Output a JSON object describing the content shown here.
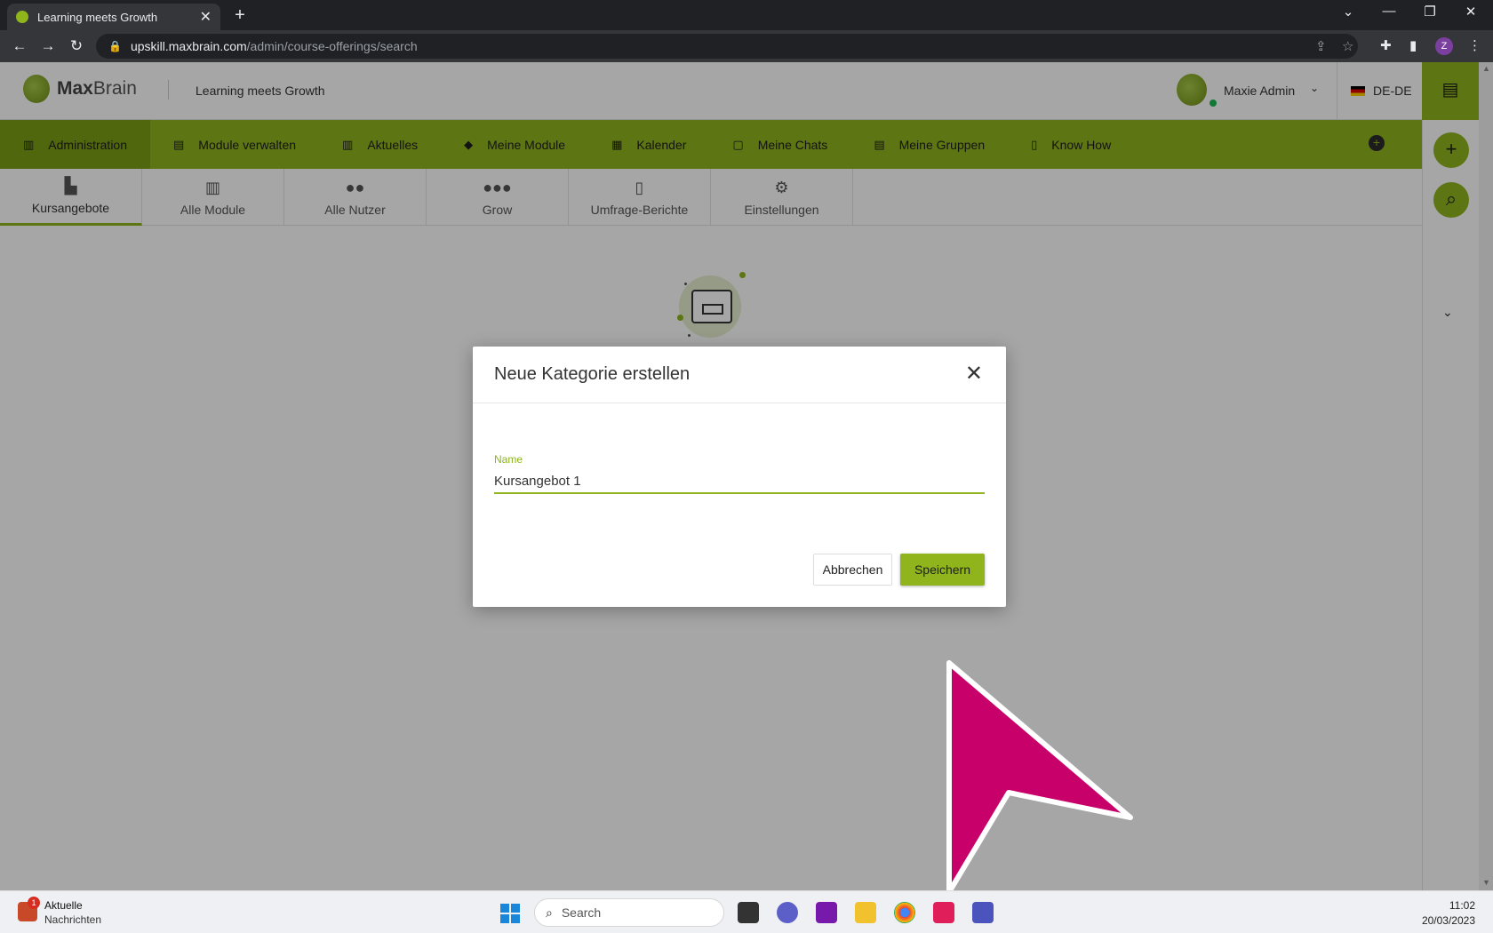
{
  "browser": {
    "tab_title": "Learning meets Growth",
    "tab_close": "✕",
    "new_tab": "+",
    "url_host": "upskill.maxbrain.com",
    "url_path": "/admin/course-offerings/search",
    "profile_initial": "Z"
  },
  "header": {
    "logo_max": "Max",
    "logo_brain": "Brain",
    "slogan": "Learning meets Growth",
    "user_name": "Maxie Admin",
    "language": "DE-DE"
  },
  "main_nav": [
    {
      "label": "Administration",
      "icon": "admin-icon"
    },
    {
      "label": "Module verwalten",
      "icon": "modules-icon"
    },
    {
      "label": "Aktuelles",
      "icon": "news-icon"
    },
    {
      "label": "Meine Module",
      "icon": "graduation-cap-icon"
    },
    {
      "label": "Kalender",
      "icon": "calendar-icon"
    },
    {
      "label": "Meine Chats",
      "icon": "chat-icon"
    },
    {
      "label": "Meine Gruppen",
      "icon": "groups-icon"
    },
    {
      "label": "Know How",
      "icon": "book-icon"
    }
  ],
  "sub_nav": [
    {
      "label": "Kursangebote",
      "icon": "course-offerings-icon"
    },
    {
      "label": "Alle Module",
      "icon": "institution-icon"
    },
    {
      "label": "Alle Nutzer",
      "icon": "users-icon"
    },
    {
      "label": "Grow",
      "icon": "group-icon"
    },
    {
      "label": "Umfrage-Berichte",
      "icon": "report-icon"
    },
    {
      "label": "Einstellungen",
      "icon": "gears-icon"
    }
  ],
  "dialog": {
    "title": "Neue Kategorie erstellen",
    "field_label": "Name",
    "field_value": "Kursangebot 1",
    "cancel_label": "Abbrechen",
    "save_label": "Speichern"
  },
  "taskbar": {
    "notif_count": "1",
    "notif_line1": "Aktuelle",
    "notif_line2": "Nachrichten",
    "search_placeholder": "Search",
    "time": "11:02",
    "date": "20/03/2023"
  },
  "colors": {
    "accent": "#8fb41c",
    "cursor": "#c8006a"
  }
}
